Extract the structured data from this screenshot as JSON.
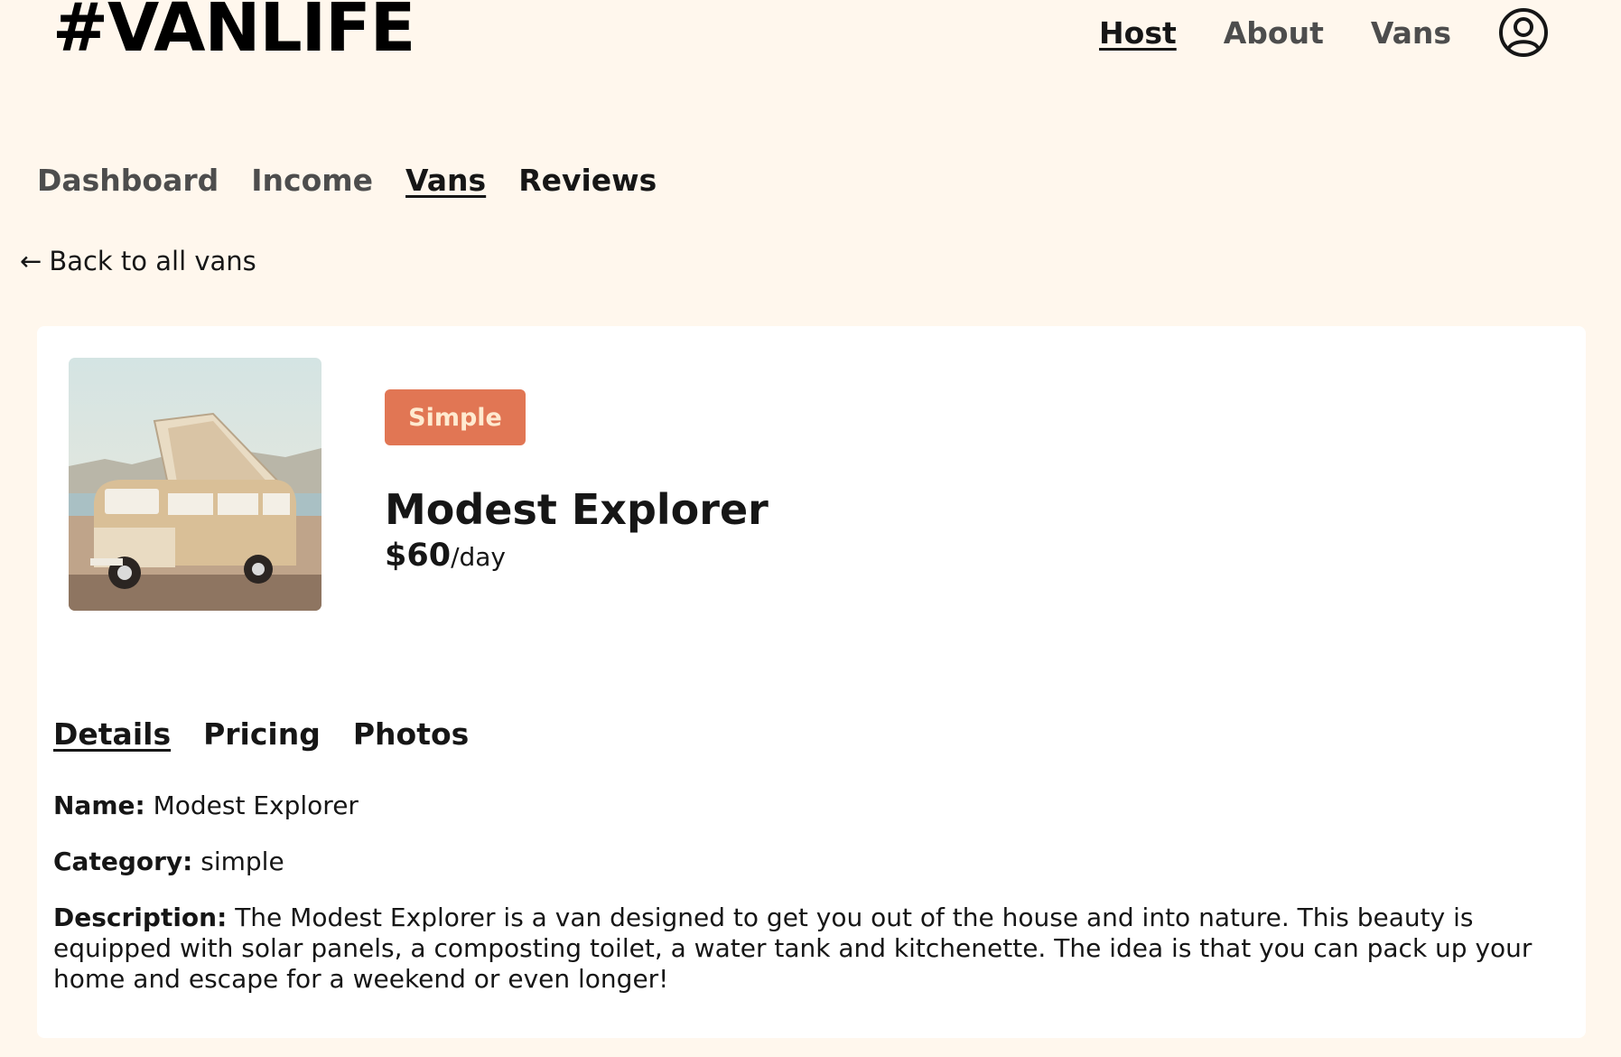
{
  "header": {
    "logo": "#VANLIFE",
    "nav": [
      {
        "label": "Host",
        "active": true
      },
      {
        "label": "About",
        "active": false
      },
      {
        "label": "Vans",
        "active": false
      }
    ],
    "avatar_icon": "user-circle-icon"
  },
  "host_nav": [
    {
      "label": "Dashboard",
      "active": false
    },
    {
      "label": "Income",
      "active": false
    },
    {
      "label": "Vans",
      "active": true
    },
    {
      "label": "Reviews",
      "active": false
    }
  ],
  "back_link": {
    "arrow": "←",
    "label": "Back to all vans"
  },
  "van": {
    "type_badge": "Simple",
    "name": "Modest Explorer",
    "price_amount": "$60",
    "price_unit": "/day",
    "badge_color": "#E17654"
  },
  "tabs": [
    {
      "label": "Details",
      "active": true
    },
    {
      "label": "Pricing",
      "active": false
    },
    {
      "label": "Photos",
      "active": false
    }
  ],
  "details": {
    "name_label": "Name:",
    "name_value": "Modest Explorer",
    "category_label": "Category:",
    "category_value": "simple",
    "description_label": "Description:",
    "description_value": "The Modest Explorer is a van designed to get you out of the house and into nature. This beauty is equipped with solar panels, a composting toilet, a water tank and kitchenette. The idea is that you can pack up your home and escape for a weekend or even longer!"
  },
  "colors": {
    "background": "#FFF7ED",
    "card": "#FFFFFF",
    "text": "#161616",
    "muted": "#4D4D4D",
    "accent": "#E17654"
  }
}
